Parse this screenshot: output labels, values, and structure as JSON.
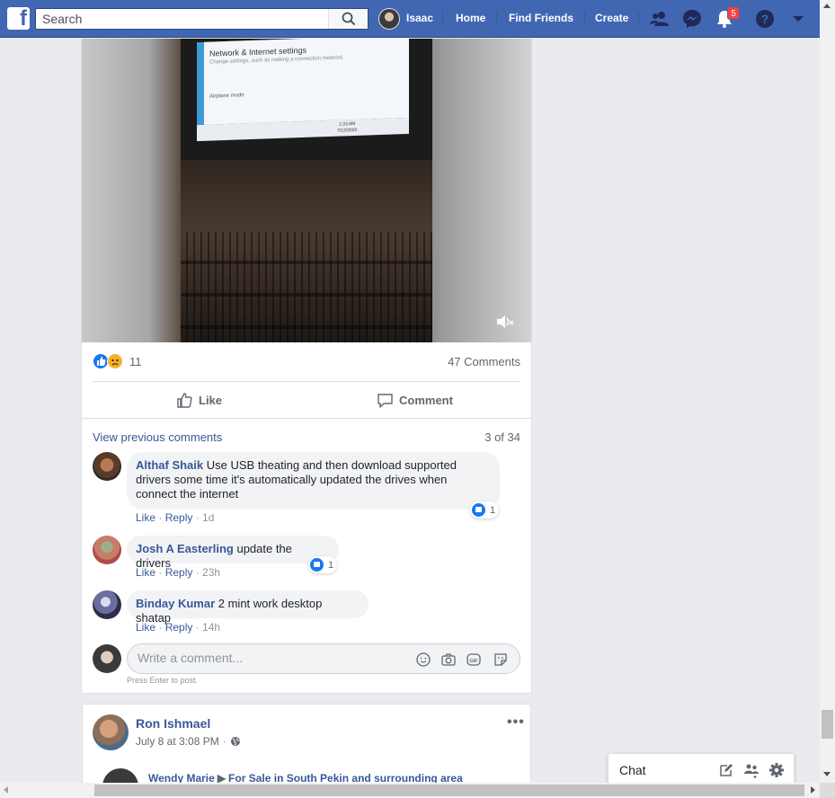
{
  "colors": {
    "brand": "#4267b2",
    "link": "#385898",
    "badge": "#fa3e3e"
  },
  "topbar": {
    "logo": "f",
    "search_placeholder": "Search",
    "user_name": "Isaac",
    "home": "Home",
    "find_friends": "Find Friends",
    "create": "Create",
    "notifications_badge": "5",
    "icons": [
      "friend-requests-icon",
      "messenger-icon",
      "notifications-icon",
      "help-icon",
      "account-menu-icon"
    ]
  },
  "video": {
    "screen_title": "Network & Internet settings",
    "screen_subtitle": "Change settings, such as making a connection metered.",
    "screen_mode": "Airplane mode",
    "taskbar_time": "1:33 AM",
    "taskbar_date": "7/12/2020"
  },
  "post": {
    "reaction_count": "11",
    "comments_count": "47 Comments",
    "like_label": "Like",
    "comment_label": "Comment",
    "view_previous": "View previous comments",
    "pager": "3 of 34"
  },
  "comments": [
    {
      "author": "Althaf Shaik",
      "text": "Use USB theating and then download supported drivers some time it's automatically updated the drives when connect the internet",
      "like": "Like",
      "reply": "Reply",
      "time": "1d",
      "likes": "1"
    },
    {
      "author": "Josh A Easterling",
      "text": "update the drivers",
      "like": "Like",
      "reply": "Reply",
      "time": "23h",
      "likes": "1"
    },
    {
      "author": "Binday Kumar",
      "text": "2 mint work desktop shatap",
      "like": "Like",
      "reply": "Reply",
      "time": "14h"
    }
  ],
  "composer": {
    "placeholder": "Write a comment...",
    "hint": "Press Enter to post."
  },
  "post2": {
    "author": "Ron Ishmael",
    "date": "July 8 at 3:08 PM",
    "more": "•••",
    "shared_author": "Wendy Marie",
    "shared_group": "For Sale in South Pekin and surrounding area"
  },
  "chat": {
    "label": "Chat"
  }
}
